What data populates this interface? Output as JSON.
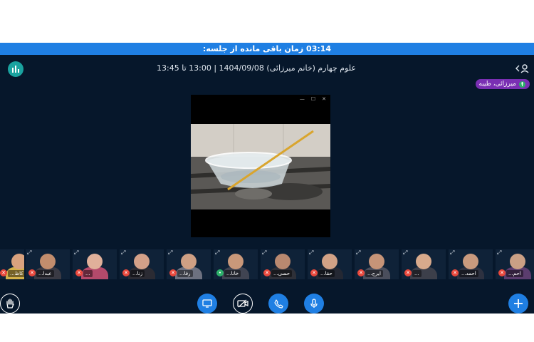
{
  "timer": {
    "label": "زمان باقی مانده از جلسه:",
    "value": "03:14"
  },
  "header": {
    "title": "علوم چهارم (خانم میرزائی) 1404/09/08 | 13:00 تا 13:45"
  },
  "presenter": {
    "name": "میرزائی، طیبه"
  },
  "screen_share": {
    "window_controls": [
      "—",
      "☐",
      "✕"
    ]
  },
  "participants": [
    {
      "name": "کاظ...",
      "mic": "muted",
      "skin": "#d9a27e",
      "cloth": "#d4b14a"
    },
    {
      "name": "عبدا...",
      "mic": "muted",
      "skin": "#c28d6d",
      "cloth": "#3a3a44"
    },
    {
      "name": "...",
      "mic": "muted",
      "skin": "#e0b09a",
      "cloth": "#b44a6b"
    },
    {
      "name": "زنا...",
      "mic": "muted",
      "skin": "#d3a088",
      "cloth": "#2b2b33"
    },
    {
      "name": "رفا...",
      "mic": "muted",
      "skin": "#cfa084",
      "cloth": "#6d7180"
    },
    {
      "name": "خانا...",
      "mic": "on",
      "skin": "#c9987a",
      "cloth": "#404452"
    },
    {
      "name": "حسی...",
      "mic": "muted",
      "skin": "#b98970",
      "cloth": "#2e3038"
    },
    {
      "name": "حقا...",
      "mic": "muted",
      "skin": "#d2a286",
      "cloth": "#242833"
    },
    {
      "name": "ایرج...",
      "mic": "muted",
      "skin": "#c69478",
      "cloth": "#4a4e5c"
    },
    {
      "name": "...",
      "mic": "muted",
      "skin": "#d8aa8c",
      "cloth": "#3c3f4a"
    },
    {
      "name": "احمد...",
      "mic": "muted",
      "skin": "#c99a7e",
      "cloth": "#2d3140"
    },
    {
      "name": "احم...",
      "mic": "muted",
      "skin": "#caa085",
      "cloth": "#5b3d6e"
    }
  ],
  "icons": {
    "stats": "bar-chart-icon",
    "user": "participants-icon",
    "raise_hand": "raise-hand-icon",
    "screen": "screen-share-icon",
    "camera": "camera-off-icon",
    "phone": "phone-icon",
    "mic": "microphone-icon",
    "plus": "plus-icon"
  },
  "colors": {
    "accent": "#1f7fe3",
    "background": "#06172b",
    "presenter_badge": "#7a2fb3",
    "muted": "#e8473b",
    "active": "#2db06a"
  }
}
